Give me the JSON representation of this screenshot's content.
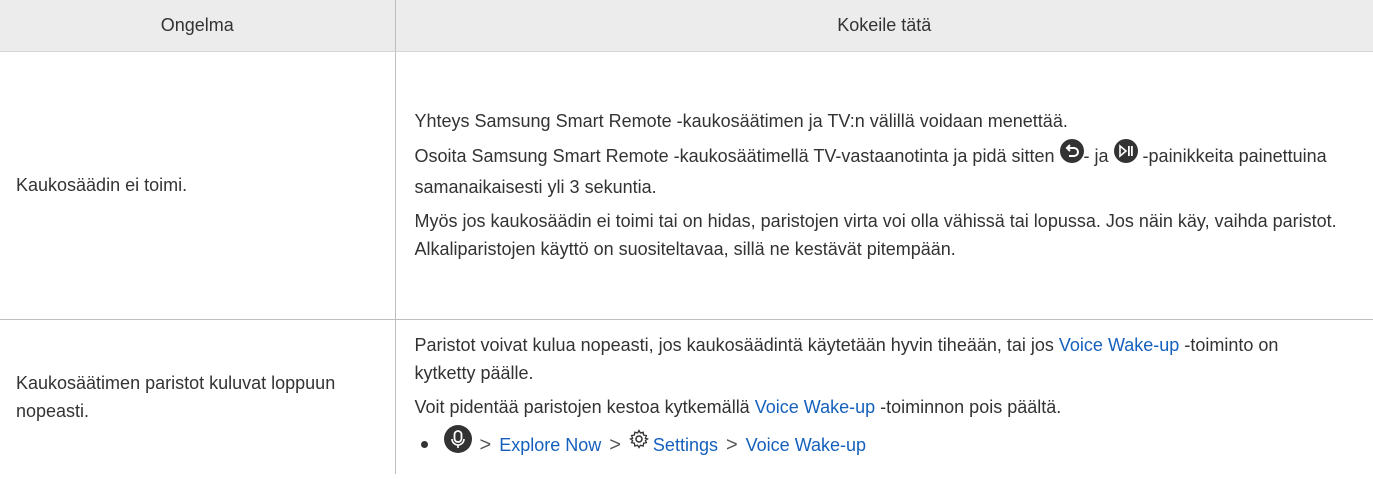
{
  "header": {
    "col1": "Ongelma",
    "col2": "Kokeile tätä"
  },
  "rows": [
    {
      "problem": "Kaukosäädin ei toimi.",
      "p1": "Yhteys Samsung Smart Remote -kaukosäätimen ja TV:n välillä voidaan menettää.",
      "p2_a": "Osoita Samsung Smart Remote -kaukosäätimellä TV-vastaanotinta ja pidä sitten",
      "p2_b": "- ja",
      "p2_c": "-painikkeita painettuina samanaikaisesti yli 3 sekuntia.",
      "p3": "Myös jos kaukosäädin ei toimi tai on hidas, paristojen virta voi olla vähissä tai lopussa. Jos näin käy, vaihda paristot. Alkaliparistojen käyttö on suositeltavaa, sillä ne kestävät pitempään."
    },
    {
      "problem": "Kaukosäätimen paristot kuluvat loppuun nopeasti.",
      "p1_a": "Paristot voivat kulua nopeasti, jos kaukosäädintä käytetään hyvin tiheään, tai jos",
      "p1_link": "Voice Wake-up",
      "p1_b": "-toiminto on kytketty päälle.",
      "p2_a": "Voit pidentää paristojen kestoa kytkemällä",
      "p2_link": "Voice Wake-up",
      "p2_b": "-toiminnon pois päältä.",
      "path": {
        "sep": ">",
        "item1": "Explore Now",
        "item2": "Settings",
        "item3": "Voice Wake-up"
      }
    }
  ],
  "icons": {
    "return": "return-icon",
    "play_pause": "play-pause-icon",
    "mic": "microphone-icon",
    "settings": "gear-icon"
  },
  "colors": {
    "link": "#1560bd",
    "header_bg": "#ececec",
    "icon": "#333333"
  }
}
